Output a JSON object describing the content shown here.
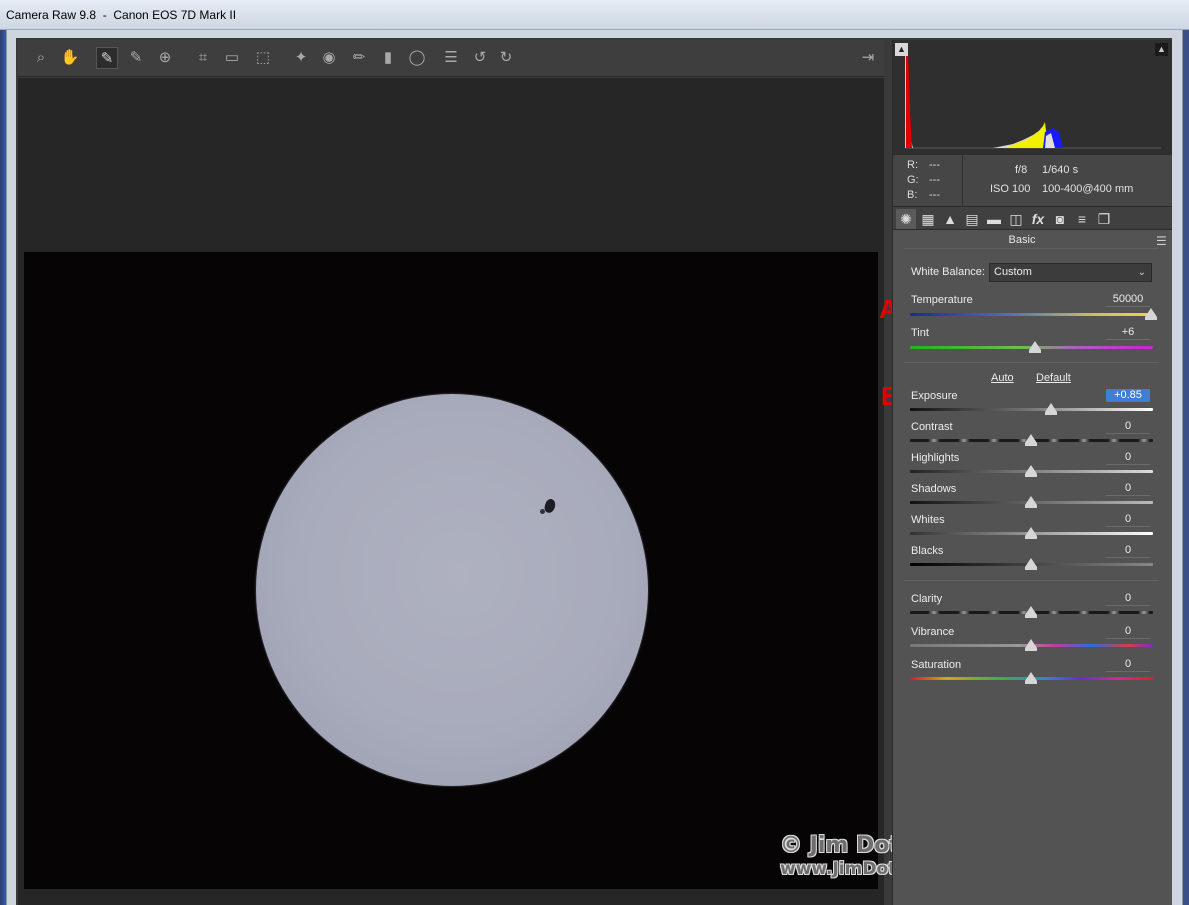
{
  "window": {
    "title": "Camera Raw 9.8  -  Canon EOS 7D Mark II"
  },
  "toolbar": {
    "tools": [
      {
        "name": "zoom-tool-icon",
        "glyph": "⌕"
      },
      {
        "name": "hand-tool-icon",
        "glyph": "✋"
      },
      {
        "name": "white-balance-tool-icon",
        "glyph": "✎"
      },
      {
        "name": "color-sampler-tool-icon",
        "glyph": "✎"
      },
      {
        "name": "targeted-adjustment-tool-icon",
        "glyph": "⊕"
      },
      {
        "name": "crop-tool-icon",
        "glyph": "⌗"
      },
      {
        "name": "straighten-tool-icon",
        "glyph": "▭"
      },
      {
        "name": "transform-tool-icon",
        "glyph": "⬚"
      },
      {
        "name": "spot-removal-tool-icon",
        "glyph": "✦"
      },
      {
        "name": "red-eye-removal-tool-icon",
        "glyph": "◉"
      },
      {
        "name": "adjustment-brush-icon",
        "glyph": "✏"
      },
      {
        "name": "graduated-filter-icon",
        "glyph": "▮"
      },
      {
        "name": "radial-filter-icon",
        "glyph": "◯"
      },
      {
        "name": "preferences-icon",
        "glyph": "☰"
      },
      {
        "name": "rotate-left-icon",
        "glyph": "↺"
      },
      {
        "name": "rotate-right-icon",
        "glyph": "↻"
      }
    ],
    "export_glyph": "⇥"
  },
  "watermark": {
    "copyright": "© Jim Doty, Jr.",
    "url": "www.JimDoty.com"
  },
  "annotations": {
    "a": "A",
    "b": "B"
  },
  "info": {
    "r_label": "R:",
    "r_value": "---",
    "g_label": "G:",
    "g_value": "---",
    "b_label": "B:",
    "b_value": "---",
    "aperture": "f/8",
    "shutter": "1/640 s",
    "iso": "ISO 100",
    "lens": "100-400@400 mm"
  },
  "panel_tabs": [
    {
      "name": "tab-basic",
      "glyph": "✺"
    },
    {
      "name": "tab-tone-curve",
      "glyph": "▦"
    },
    {
      "name": "tab-detail",
      "glyph": "▲"
    },
    {
      "name": "tab-hsl",
      "glyph": "▤"
    },
    {
      "name": "tab-split-toning",
      "glyph": "▬"
    },
    {
      "name": "tab-lens-corrections",
      "glyph": "◫"
    },
    {
      "name": "tab-effects",
      "glyph": "fx"
    },
    {
      "name": "tab-camera-calibration",
      "glyph": "◙"
    },
    {
      "name": "tab-presets",
      "glyph": "≡"
    },
    {
      "name": "tab-snapshots",
      "glyph": "❐"
    }
  ],
  "basic": {
    "title": "Basic",
    "white_balance_label": "White Balance:",
    "white_balance_value": "Custom",
    "auto_label": "Auto",
    "default_label": "Default",
    "sliders": [
      {
        "key": "temperature",
        "label": "Temperature",
        "value": "50000",
        "position": 1.0
      },
      {
        "key": "tint",
        "label": "Tint",
        "value": "+6",
        "position": 0.52
      },
      {
        "key": "exposure",
        "label": "Exposure",
        "value": "+0.85",
        "position": 0.585
      },
      {
        "key": "contrast",
        "label": "Contrast",
        "value": "0",
        "position": 0.5
      },
      {
        "key": "highlights",
        "label": "Highlights",
        "value": "0",
        "position": 0.5
      },
      {
        "key": "shadows",
        "label": "Shadows",
        "value": "0",
        "position": 0.5
      },
      {
        "key": "whites",
        "label": "Whites",
        "value": "0",
        "position": 0.5
      },
      {
        "key": "blacks",
        "label": "Blacks",
        "value": "0",
        "position": 0.5
      },
      {
        "key": "clarity",
        "label": "Clarity",
        "value": "0",
        "position": 0.5
      },
      {
        "key": "vibrance",
        "label": "Vibrance",
        "value": "0",
        "position": 0.5
      },
      {
        "key": "saturation",
        "label": "Saturation",
        "value": "0",
        "position": 0.5
      }
    ]
  }
}
